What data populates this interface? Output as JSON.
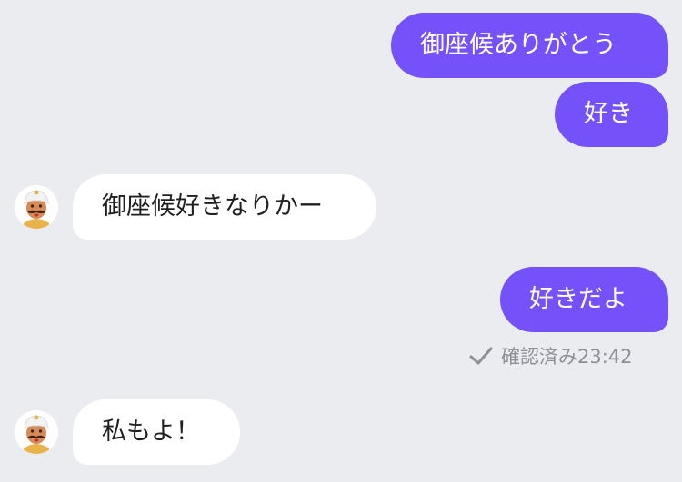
{
  "chat": {
    "messages": [
      {
        "sender": "me",
        "text": "御座候ありがとう"
      },
      {
        "sender": "me",
        "text": "好き"
      },
      {
        "sender": "other",
        "text": "御座候好きなりかー"
      },
      {
        "sender": "me",
        "text": "好きだよ"
      },
      {
        "sender": "other",
        "text": "私もよ！"
      }
    ],
    "read_status": "確認済み23:42"
  },
  "icons": {
    "read_check": "checkmark-icon",
    "avatar": "turban-man-avatar"
  },
  "colors": {
    "background": "#ebecf0",
    "outgoing_bubble": "#7451f8",
    "incoming_bubble": "#ffffff",
    "status_text": "#8d8f96"
  }
}
